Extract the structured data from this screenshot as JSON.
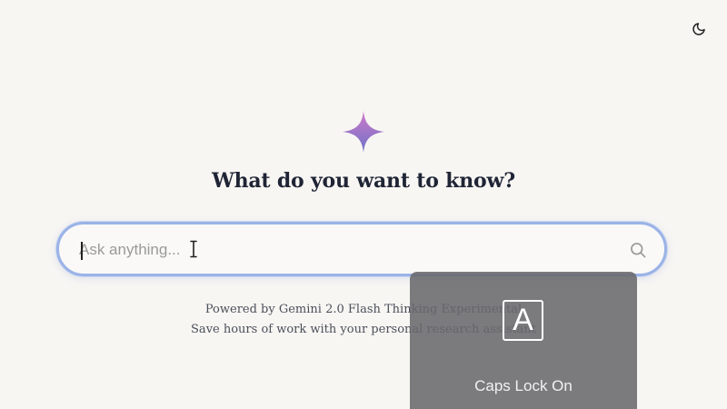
{
  "header": {
    "theme_toggle_icon": "moon-icon"
  },
  "hero": {
    "logo_icon": "sparkle-icon",
    "headline": "What do you want to know?"
  },
  "search": {
    "placeholder": "Ask anything...",
    "value": "",
    "submit_icon": "search-icon"
  },
  "footer": {
    "powered_by": "Powered by Gemini 2.0 Flash Thinking Experimental",
    "tagline": "Save hours of work with your personal research assistant"
  },
  "os_overlay": {
    "key_glyph": "A",
    "label": "Caps Lock On"
  },
  "colors": {
    "background": "#f8f6f3",
    "search_border": "#9bb3e6",
    "sparkle_top": "#d179c9",
    "sparkle_bottom": "#6d72c8"
  }
}
